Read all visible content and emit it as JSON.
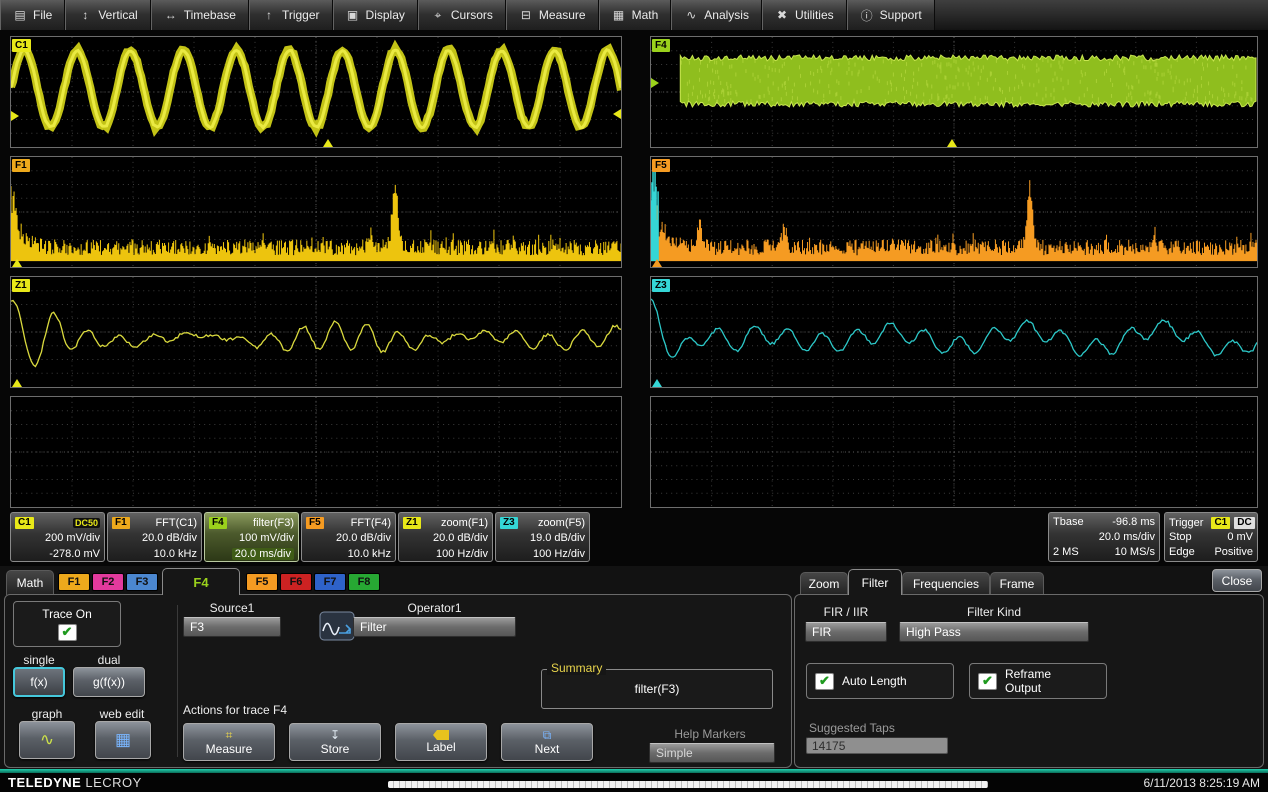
{
  "colors": {
    "c1": "#e8e819",
    "f1_chip": "#eda91c",
    "f2": "#e23a9d",
    "f3": "#4b87d0",
    "f4": "#9ad11c",
    "f5": "#f59b22",
    "f6": "#cc2222",
    "f7": "#2e62c9",
    "f8": "#27a833",
    "z3": "#35d6d6",
    "accent": "#17b79a",
    "select_border": "#45c8dc"
  },
  "icons": {
    "check": "✔",
    "file": "▤",
    "vertical": "↕",
    "timebase": "↔",
    "trigger": "↑",
    "display": "▣",
    "cursors": "⌖",
    "measure": "⊟",
    "math": "▦",
    "analysis": "∿",
    "utilities": "✖",
    "support": "ⓘ",
    "measure_btn": "⌗",
    "store_btn": "↧",
    "next_btn": "⧉",
    "graph_btn": "∿",
    "webedit_btn": "▦"
  },
  "menu": {
    "items": [
      {
        "label": "File"
      },
      {
        "label": "Vertical"
      },
      {
        "label": "Timebase"
      },
      {
        "label": "Trigger"
      },
      {
        "label": "Display"
      },
      {
        "label": "Cursors"
      },
      {
        "label": "Measure"
      },
      {
        "label": "Math"
      },
      {
        "label": "Analysis"
      },
      {
        "label": "Utilities"
      },
      {
        "label": "Support"
      }
    ]
  },
  "grids": {
    "left": [
      {
        "chip": "C1",
        "chip_color": "#e8e819",
        "wave": {
          "type": "sine",
          "color": "#c3c316",
          "color2": "#ecec44",
          "cycles": 11.5,
          "amp": 0.35,
          "center": 0.47,
          "seed": 7
        },
        "markers": [
          {
            "kind": "up",
            "x": 0.52,
            "color": "#e8e819"
          },
          {
            "kind": "left",
            "y": 0.7,
            "color": "#e8e819"
          },
          {
            "kind": "right",
            "y": 0.72,
            "color": "#e8e819"
          }
        ]
      },
      {
        "chip": "F1",
        "chip_color": "#eda91c",
        "wave": {
          "type": "spectrum",
          "color": "#edc40e",
          "spike": 0.63,
          "minor": [
            {
              "x": 0.59,
              "a": 14
            }
          ],
          "seed": 13
        },
        "markers": [
          {
            "kind": "up",
            "x": 0.01,
            "color": "#e8e819"
          }
        ]
      },
      {
        "chip": "Z1",
        "chip_color": "#e8e819",
        "wave": {
          "type": "zoomwave",
          "color": "#d9d93e",
          "osc": {
            "a": 45,
            "tau": 30,
            "f": 7
          },
          "seed": 19
        },
        "markers": [
          {
            "kind": "up",
            "x": 0.01,
            "color": "#e8e819"
          }
        ]
      },
      {
        "chip": "",
        "wave": {
          "type": "empty"
        },
        "markers": []
      }
    ],
    "right": [
      {
        "chip": "F4",
        "chip_color": "#9ad11c",
        "wave": {
          "type": "band",
          "color": "#8fbe1e",
          "color2": "#c9e650",
          "start": 0.049,
          "center": 0.4,
          "half": 0.21,
          "seed": 23
        },
        "markers": [
          {
            "kind": "up",
            "x": 0.497,
            "color": "#e8e819"
          },
          {
            "kind": "right",
            "y": 0.42,
            "color": "#9ad11c"
          }
        ]
      },
      {
        "chip": "F5",
        "chip_color": "#f59b22",
        "wave": {
          "type": "spectrum",
          "color": "#f59b22",
          "spike": 0.625,
          "minor": [
            {
              "x": 0.08,
              "a": 26
            },
            {
              "x": 0.22,
              "a": 20
            },
            {
              "x": 0.83,
              "a": 16
            }
          ],
          "leftblob": "#35d6d6",
          "seed": 29
        },
        "markers": [
          {
            "kind": "up",
            "x": 0.01,
            "color": "#f59b22"
          }
        ]
      },
      {
        "chip": "Z3",
        "chip_color": "#35d6d6",
        "wave": {
          "type": "zoomwave",
          "color": "#2cc8c8",
          "osc": {
            "a": 28,
            "tau": 40,
            "f": 9
          },
          "seed": 31
        },
        "markers": [
          {
            "kind": "up",
            "x": 0.01,
            "color": "#35d6d6"
          }
        ]
      },
      {
        "chip": "",
        "wave": {
          "type": "empty"
        },
        "markers": []
      }
    ]
  },
  "descriptors": [
    {
      "chip": "C1",
      "chip_color": "#e8e819",
      "title": "",
      "badge": "DC50",
      "line2": "200 mV/div",
      "line3": "-278.0 mV"
    },
    {
      "chip": "F1",
      "chip_color": "#eda91c",
      "title": "FFT(C1)",
      "badge": "",
      "line2": "20.0 dB/div",
      "line3": "10.0 kHz"
    },
    {
      "chip": "F4",
      "chip_color": "#9ad11c",
      "title": "filter(F3)",
      "badge": "",
      "line2": "100 mV/div",
      "line3": "20.0 ms/div"
    },
    {
      "chip": "F5",
      "chip_color": "#f59b22",
      "title": "FFT(F4)",
      "badge": "",
      "line2": "20.0 dB/div",
      "line3": "10.0 kHz"
    },
    {
      "chip": "Z1",
      "chip_color": "#e8e819",
      "title": "zoom(F1)",
      "badge": "",
      "line2": "20.0 dB/div",
      "line3": "100 Hz/div"
    },
    {
      "chip": "Z3",
      "chip_color": "#35d6d6",
      "title": "zoom(F5)",
      "badge": "",
      "line2": "19.0 dB/div",
      "line3": "100 Hz/div"
    }
  ],
  "timebase": {
    "label": "Tbase",
    "offset": "-96.8 ms",
    "scale": "20.0 ms/div",
    "record": "2 MS",
    "rate": "10 MS/s"
  },
  "trigger": {
    "label": "Trigger",
    "source": "C1",
    "coupling": "DC",
    "mode": "Stop",
    "level": "0 mV",
    "type": "Edge",
    "slope": "Positive"
  },
  "dialog": {
    "tabs": {
      "math": "Math",
      "f1": "F1",
      "f2": "F2",
      "f3": "F3",
      "f4": "F4",
      "f5": "F5",
      "f6": "F6",
      "f7": "F7",
      "f8": "F8"
    },
    "trace_on": "Trace On",
    "single": "single",
    "dual": "dual",
    "fx": "f(x)",
    "gfx": "g(f(x))",
    "graph": "graph",
    "web_edit": "web edit",
    "source1_label": "Source1",
    "source1_value": "F3",
    "operator1_label": "Operator1",
    "operator1_value": "Filter",
    "summary_label": "Summary",
    "summary_value": "filter(F3)",
    "actions_label": "Actions for trace F4",
    "measure": "Measure",
    "store": "Store",
    "label_btn": "Label",
    "next": "Next",
    "help_markers_label": "Help Markers",
    "help_markers_value": "Simple"
  },
  "right_panel": {
    "tabs": {
      "zoom": "Zoom",
      "filter": "Filter",
      "frequencies": "Frequencies",
      "frame": "Frame"
    },
    "close": "Close",
    "fir_iir_label": "FIR / IIR",
    "fir_value": "FIR",
    "filter_kind_label": "Filter Kind",
    "filter_kind_value": "High Pass",
    "auto_length": "Auto Length",
    "reframe_line1": "Reframe",
    "reframe_line2": "Output",
    "suggested_taps_label": "Suggested Taps",
    "suggested_taps_value": "14175"
  },
  "status": {
    "brand1": "TELEDYNE",
    "brand2": "LECROY",
    "datetime": "6/11/2013 8:25:19 AM"
  }
}
